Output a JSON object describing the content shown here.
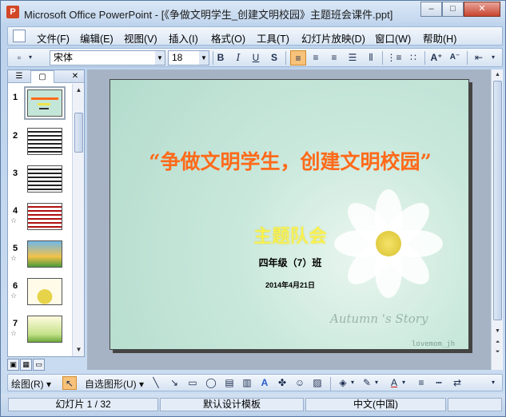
{
  "window": {
    "title": "Microsoft Office PowerPoint - [《争做文明学生_创建文明校园》主题班会课件.ppt]",
    "minimize": "–",
    "restore": "□",
    "close": "✕"
  },
  "menu": [
    "文件(F)",
    "编辑(E)",
    "视图(V)",
    "插入(I)",
    "格式(O)",
    "工具(T)",
    "幻灯片放映(D)",
    "窗口(W)",
    "帮助(H)"
  ],
  "toolbar": {
    "font": "宋体",
    "size": "18",
    "bold": "B",
    "italic": "I",
    "underline": "U",
    "shadow": "S"
  },
  "panel": {
    "close": "✕",
    "slide_numbers": [
      "1",
      "2",
      "3",
      "4",
      "5",
      "6",
      "7"
    ]
  },
  "slide": {
    "title": "“争做文明学生，创建文明校园”",
    "subtitle": "主题队会",
    "class": "四年级（7）班",
    "date": "2014年4月21日",
    "watermark1": "Autumn 's Story",
    "watermark2": "lovemom_jh"
  },
  "draw": {
    "draw_label": "绘图(R)",
    "autoshape_label": "自选图形(U)"
  },
  "status": {
    "slide_count": "幻灯片 1 / 32",
    "template": "默认设计模板",
    "language": "中文(中国)"
  },
  "colors": {
    "title": "#ff6a1a",
    "subtitle": "#fff54a",
    "slide_bg": "#c9e8dc"
  }
}
